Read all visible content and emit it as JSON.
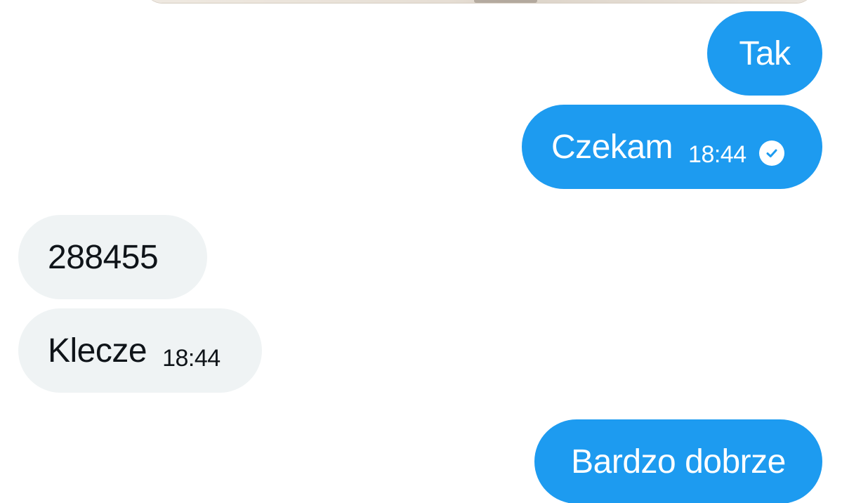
{
  "conversation": {
    "media_preview": {
      "icon": "image-preview"
    },
    "messages": [
      {
        "direction": "outgoing",
        "text": "Tak"
      },
      {
        "direction": "outgoing",
        "text": "Czekam",
        "time": "18:44",
        "status_icon": "sent-check-icon"
      },
      {
        "direction": "incoming",
        "text": "288455"
      },
      {
        "direction": "incoming",
        "text": "Klecze",
        "time": "18:44"
      },
      {
        "direction": "outgoing",
        "text": "Bardzo dobrze"
      }
    ]
  },
  "colors": {
    "outgoing_bubble": "#1d9bf0",
    "incoming_bubble": "#eff3f4",
    "incoming_text": "#0f1419",
    "outgoing_text": "#ffffff"
  }
}
